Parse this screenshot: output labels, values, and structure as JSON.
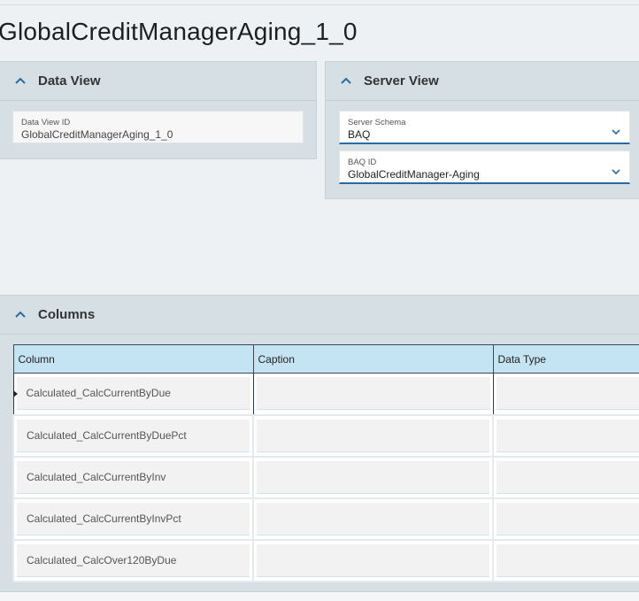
{
  "page_title": "GlobalCreditManagerAging_1_0",
  "data_view": {
    "title": "Data View",
    "data_view_id_label": "Data View ID",
    "data_view_id_value": "GlobalCreditManagerAging_1_0"
  },
  "server_view": {
    "title": "Server View",
    "schema_label": "Server Schema",
    "schema_value": "BAQ",
    "baq_id_label": "BAQ ID",
    "baq_id_value": "GlobalCreditManager-Aging"
  },
  "columns_panel": {
    "title": "Columns",
    "headers": [
      "Column",
      "Caption",
      "Data Type"
    ],
    "rows": [
      {
        "column": "Calculated_CalcCurrentByDue",
        "caption": "",
        "data_type": ""
      },
      {
        "column": "Calculated_CalcCurrentByDuePct",
        "caption": "",
        "data_type": ""
      },
      {
        "column": "Calculated_CalcCurrentByInv",
        "caption": "",
        "data_type": ""
      },
      {
        "column": "Calculated_CalcCurrentByInvPct",
        "caption": "",
        "data_type": ""
      },
      {
        "column": "Calculated_CalcOver120ByDue",
        "caption": "",
        "data_type": ""
      }
    ]
  },
  "colors": {
    "accent": "#2a6aa0",
    "header_bg": "#c4e3f3",
    "panel_bg": "#d6e0e4"
  }
}
